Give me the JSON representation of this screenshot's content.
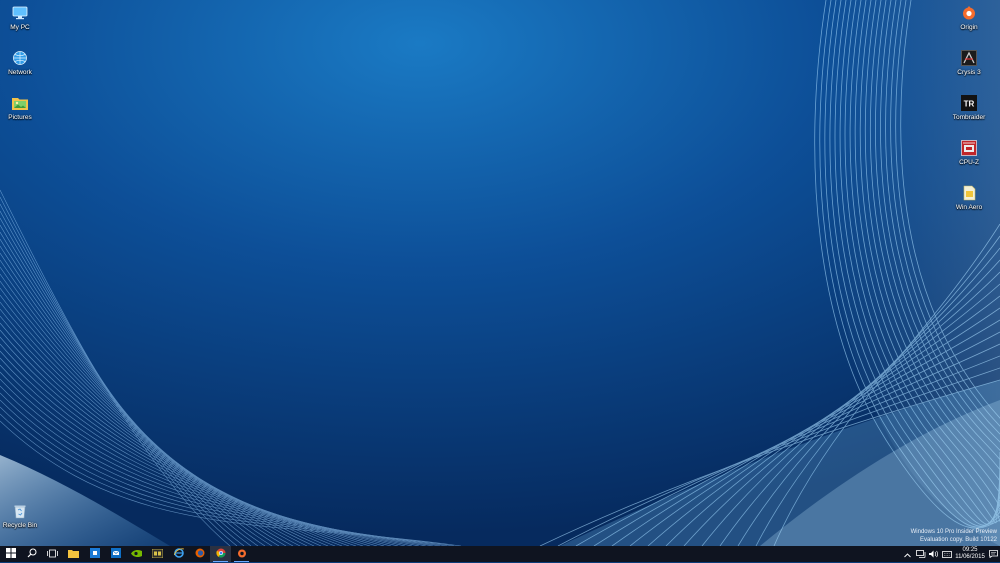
{
  "desktop": {
    "left_icons": [
      {
        "label": "My PC",
        "icon": "computer-icon"
      },
      {
        "label": "Network",
        "icon": "network-globe-icon"
      },
      {
        "label": "Pictures",
        "icon": "pictures-folder-icon"
      }
    ],
    "right_icons": [
      {
        "label": "Origin",
        "icon": "origin-icon"
      },
      {
        "label": "Crysis 3",
        "icon": "crysis3-icon"
      },
      {
        "label": "Tombraider",
        "icon": "tombraider-icon"
      },
      {
        "label": "CPU-Z",
        "icon": "cpuz-icon"
      },
      {
        "label": "Win Aero",
        "icon": "winaero-icon"
      }
    ],
    "recycle_bin": {
      "label": "Recycle Bin",
      "icon": "recycle-bin-icon"
    }
  },
  "watermark": {
    "line1": "Windows 10 Pro Insider Preview",
    "line2": "Evaluation copy. Build 10122"
  },
  "taskbar": {
    "items": [
      {
        "icon": "start-windows-icon",
        "state": "normal"
      },
      {
        "icon": "search-icon",
        "state": "normal"
      },
      {
        "icon": "task-view-icon",
        "state": "normal"
      },
      {
        "icon": "file-explorer-icon",
        "state": "normal"
      },
      {
        "icon": "store-icon",
        "state": "normal"
      },
      {
        "icon": "mail-icon",
        "state": "normal"
      },
      {
        "icon": "nvidia-icon",
        "state": "normal"
      },
      {
        "icon": "gpuz-icon",
        "state": "normal"
      },
      {
        "icon": "internet-explorer-icon",
        "state": "normal"
      },
      {
        "icon": "firefox-icon",
        "state": "normal"
      },
      {
        "icon": "chrome-icon",
        "state": "active"
      },
      {
        "icon": "origin-app-icon",
        "state": "running"
      }
    ],
    "tray": {
      "icons": [
        "show-hidden-chevron-icon",
        "network-icon",
        "volume-icon",
        "keyboard-icon",
        "action-center-icon"
      ],
      "time": "09:25",
      "date": "11/06/2015"
    }
  },
  "colors": {
    "wallpaper_center": "#1a7ac4",
    "wallpaper_edge": "#062a5e",
    "taskbar": "#0f1420"
  }
}
